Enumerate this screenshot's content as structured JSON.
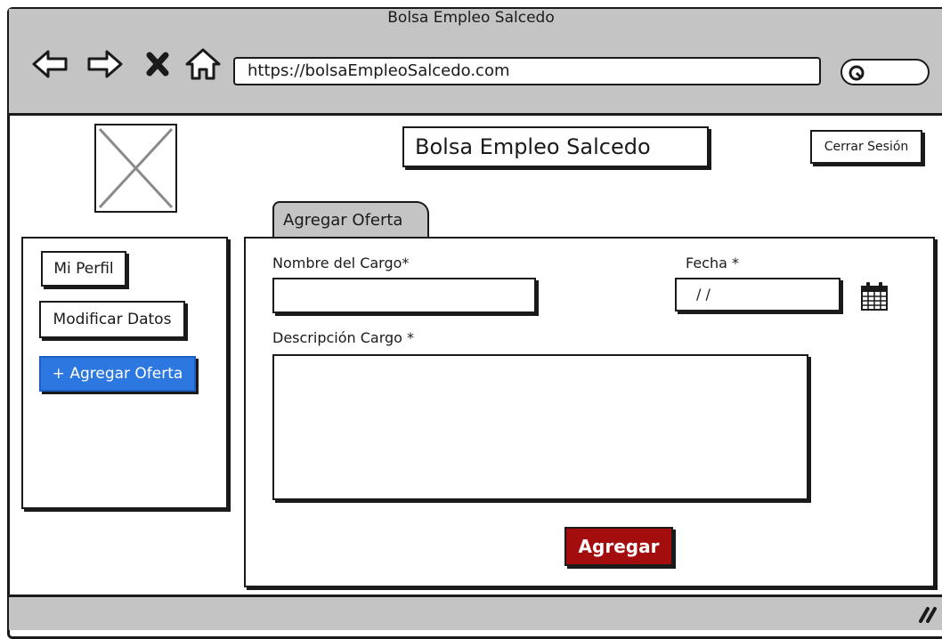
{
  "browser": {
    "window_title": "Bolsa Empleo Salcedo",
    "url": "https://bolsaEmpleoSalcedo.com",
    "icons": [
      "back-icon",
      "forward-icon",
      "close-icon",
      "home-icon",
      "search-icon",
      "resize-grip-icon"
    ]
  },
  "header": {
    "title": "Bolsa Empleo Salcedo",
    "logout_label": "Cerrar Sesión"
  },
  "sidebar": {
    "items": [
      {
        "label": "Mi Perfil"
      },
      {
        "label": "Modificar Datos"
      },
      {
        "label": "+ Agregar Oferta",
        "active": true
      }
    ],
    "active_color": "#2d77e0"
  },
  "form": {
    "tab_label": "Agregar Oferta",
    "cargo_label": "Nombre del Cargo*",
    "cargo_value": "",
    "fecha_label": "Fecha *",
    "fecha_value": "/ /",
    "descripcion_label": "Descripción Cargo *",
    "descripcion_value": "",
    "submit_label": "Agregar",
    "submit_color": "#a30d0d"
  }
}
